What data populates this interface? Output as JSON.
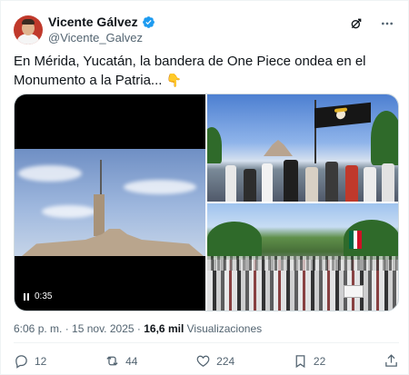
{
  "author": {
    "display_name": "Vicente Gálvez",
    "handle": "@Vicente_Galvez",
    "verified": true
  },
  "tweet": {
    "text": "En Mérida, Yucatán, la bandera de One Piece ondea en el Monumento a la Patria...",
    "emoji": "👇"
  },
  "media": {
    "video_duration": "0:35"
  },
  "meta": {
    "time": "6:06 p. m.",
    "separator": " · ",
    "date": "15 nov. 2025",
    "views_count": "16,6 mil",
    "views_label": "Visualizaciones"
  },
  "actions": {
    "replies": "12",
    "reposts": "44",
    "likes": "224",
    "bookmarks": "22"
  },
  "colors": {
    "verified_badge": "#1d9bf0",
    "secondary_text": "#536471",
    "primary_text": "#0f1419"
  },
  "icons": [
    "verified-icon",
    "grok-icon",
    "more-icon",
    "pause-icon",
    "reply-icon",
    "repost-icon",
    "like-icon",
    "bookmark-icon",
    "share-icon"
  ]
}
